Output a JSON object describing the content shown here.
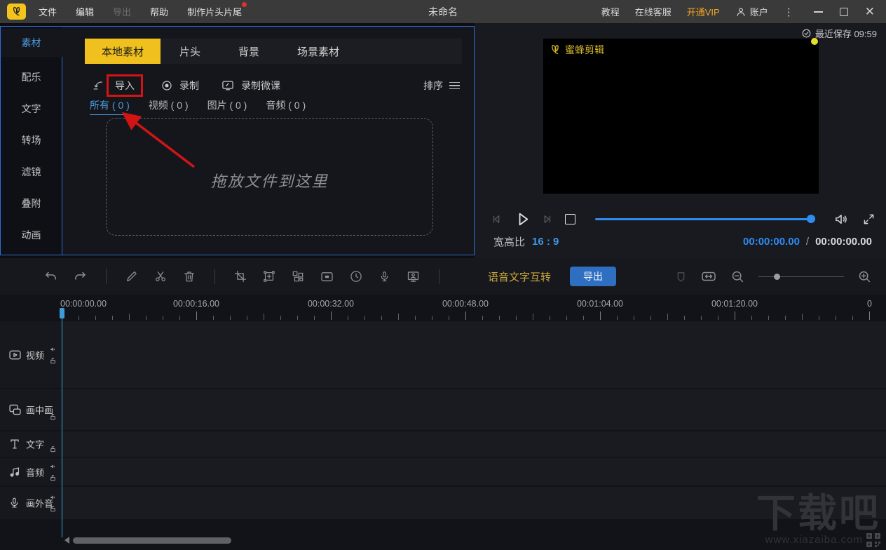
{
  "colors": {
    "accent_blue": "#2d8cf0",
    "panel_border_blue": "#2e6ed4",
    "brand_yellow": "#f0c11e",
    "annotation_red": "#d31414",
    "vip_orange": "#f5a623",
    "export_button_blue": "#2f6fc1"
  },
  "titlebar": {
    "menus": [
      "文件",
      "编辑",
      "导出",
      "帮助",
      "制作片头片尾"
    ],
    "title": "未命名",
    "tutorial": "教程",
    "support": "在线客服",
    "vip": "开通VIP",
    "account": "账户"
  },
  "sidebar": {
    "items": [
      "素材",
      "配乐",
      "文字",
      "转场",
      "滤镜",
      "叠附",
      "动画"
    ]
  },
  "material": {
    "tabs": [
      "本地素材",
      "片头",
      "背景",
      "场景素材"
    ],
    "import_label": "导入",
    "record_label": "录制",
    "record_lesson_label": "录制微课",
    "sort_label": "排序",
    "filters": [
      "所有 ( 0 )",
      "视频 ( 0 )",
      "图片 ( 0 )",
      "音频 ( 0 )"
    ],
    "dropzone_text": "拖放文件到这里"
  },
  "preview": {
    "last_saved": "最近保存 09:59",
    "video_watermark": "蜜蜂剪辑",
    "aspect_label": "宽高比",
    "aspect_value": "16 : 9",
    "current_time": "00:00:00.00",
    "time_separator": "/",
    "total_time": "00:00:00.00"
  },
  "toolbar": {
    "speech_text_label": "语音文字互转",
    "export_label": "导出"
  },
  "timeline": {
    "ruler_labels": [
      "00:00:00.00",
      "00:00:16.00",
      "00:00:32.00",
      "00:00:48.00",
      "00:01:04.00",
      "00:01:20.00",
      "0"
    ],
    "ticks": {
      "start": 88,
      "spacing": 24,
      "count": 50
    },
    "tracks": [
      {
        "label": "视频",
        "has_speaker": true
      },
      {
        "label": "画中画",
        "has_speaker": false
      },
      {
        "label": "文字",
        "has_speaker": false
      },
      {
        "label": "音频",
        "has_speaker": true
      },
      {
        "label": "画外音",
        "has_speaker": true
      }
    ]
  },
  "site_watermark": {
    "title": "下载吧",
    "url": "www.xiazaiba.com"
  }
}
